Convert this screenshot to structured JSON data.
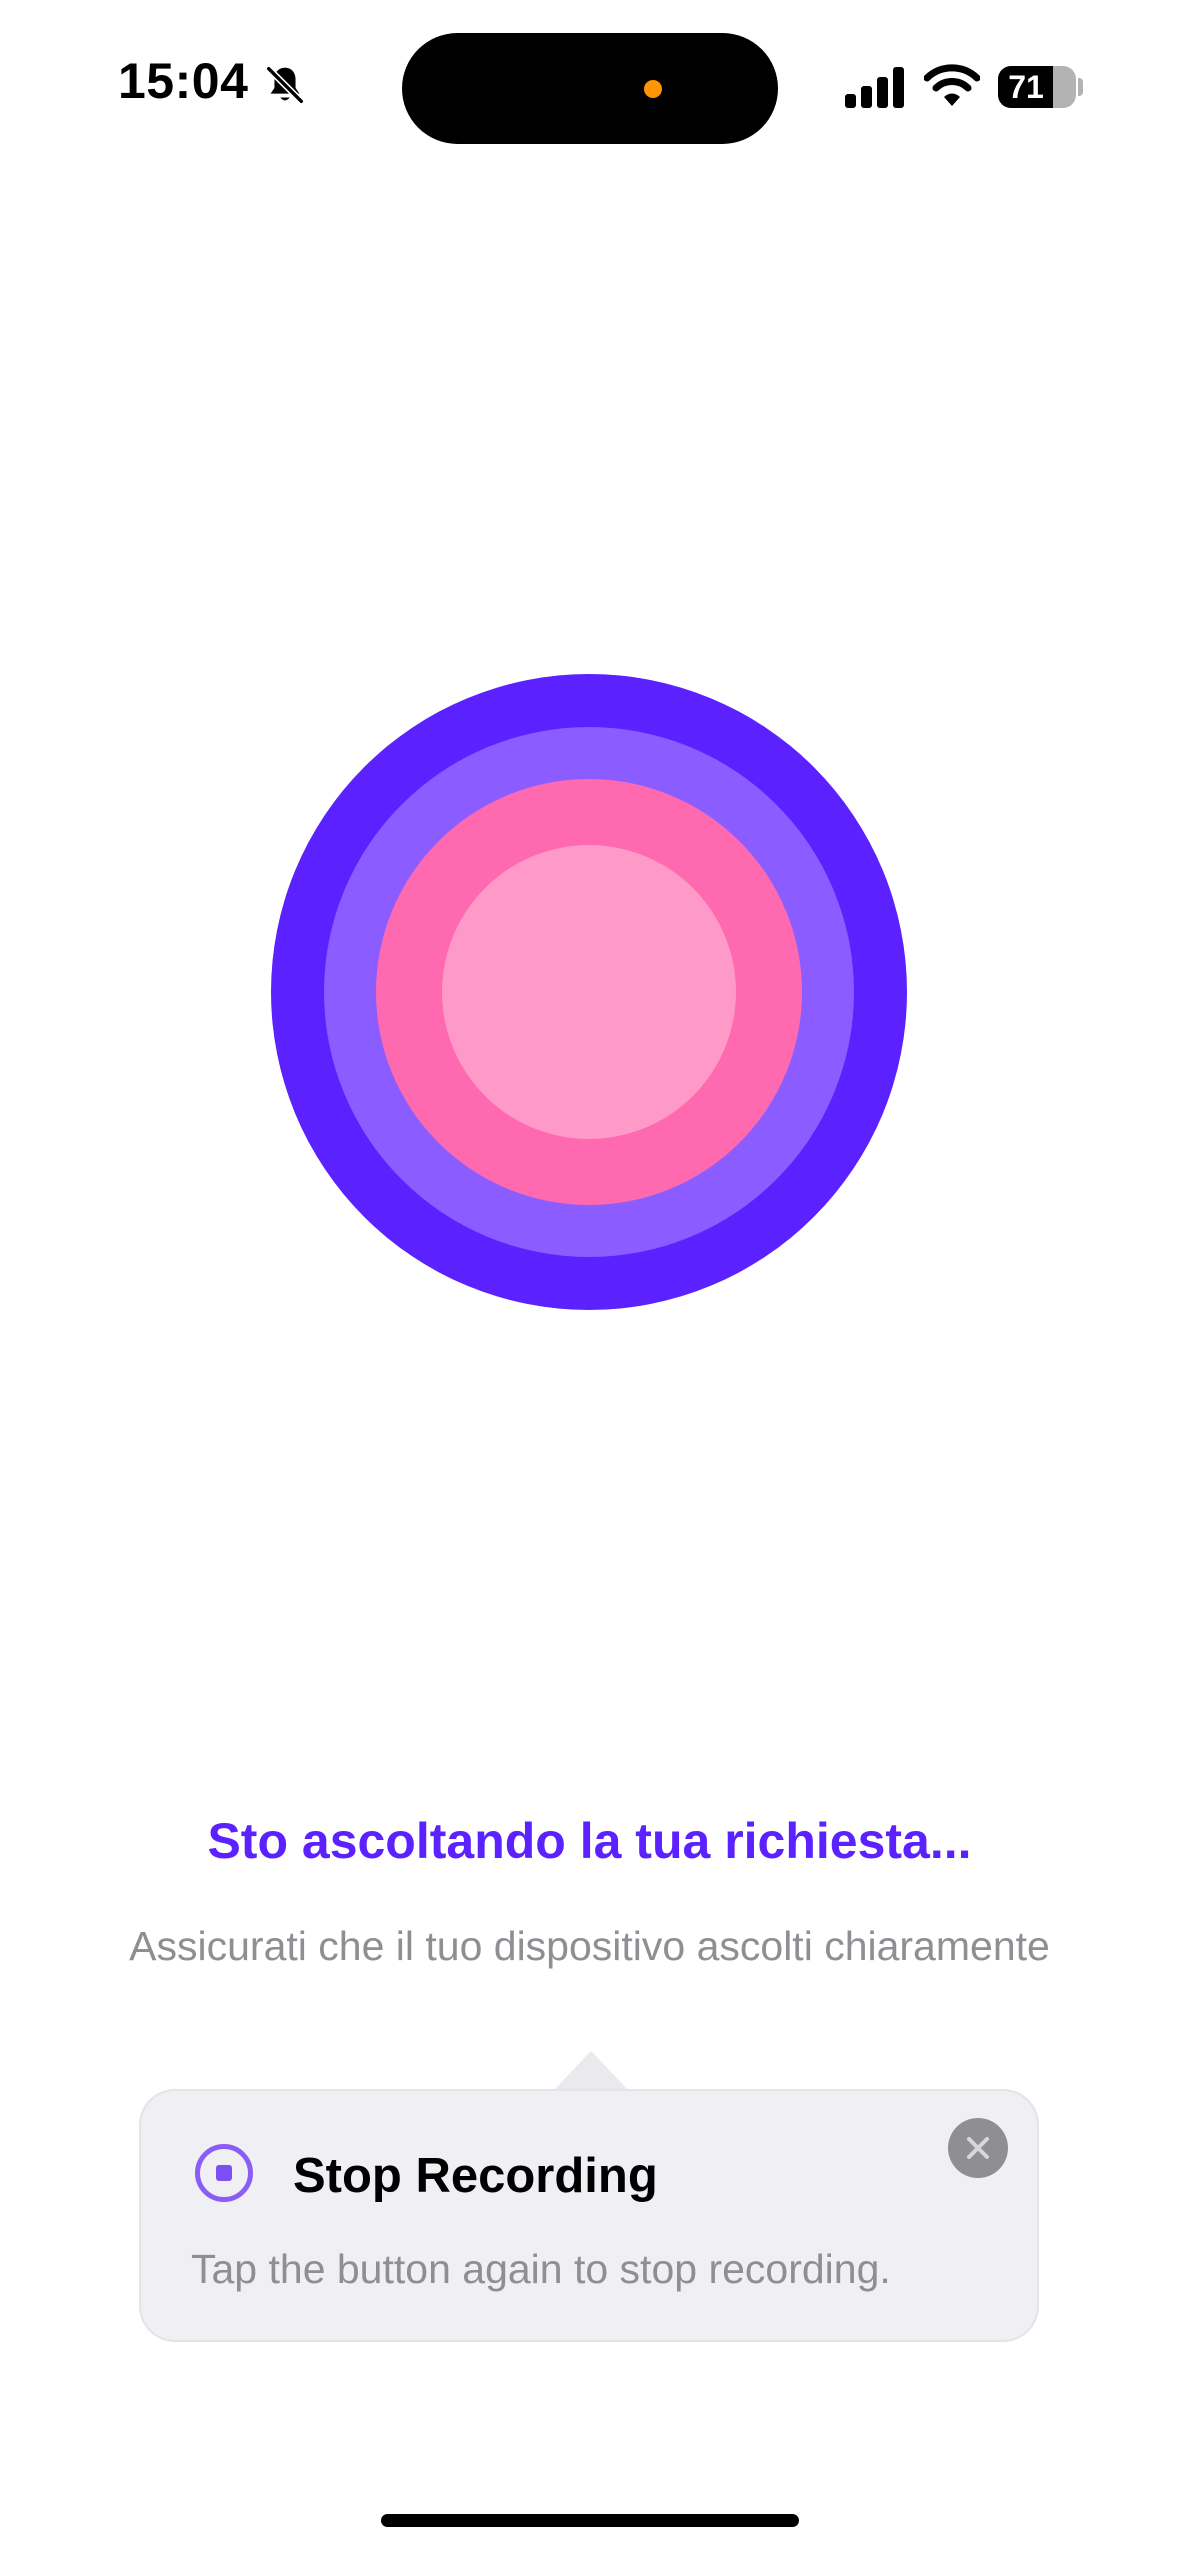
{
  "status_bar": {
    "time": "15:04",
    "battery_level": 71,
    "battery_label": "71",
    "icons": [
      "bell-slash-icon",
      "signal-icon",
      "wifi-icon",
      "battery-icon"
    ],
    "recording_indicator_color": "#ff9500"
  },
  "orb": {
    "ring_colors": [
      "#5b21ff",
      "#8b5cff",
      "#ff69b0",
      "#ff9ac8"
    ]
  },
  "listening": {
    "title": "Sto ascoltando la tua richiesta...",
    "title_color": "#5b21ff",
    "subtitle": "Assicurati che il tuo dispositivo ascolti chiaramente"
  },
  "tooltip": {
    "icon": "stop-circle-icon",
    "title": "Stop Recording",
    "body": "Tap the button again to stop recording.",
    "close_icon": "close-icon"
  }
}
